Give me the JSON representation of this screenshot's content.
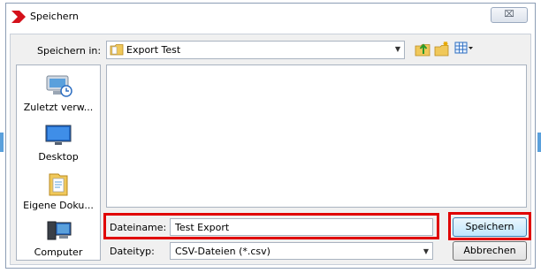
{
  "window": {
    "title": "Speichern",
    "close_glyph": "⌧"
  },
  "toolbar": {
    "save_in_label": "Speichern in:",
    "current_folder": "Export Test",
    "icons": [
      "up-folder-icon",
      "new-folder-icon",
      "view-menu-icon"
    ]
  },
  "places": [
    {
      "label": "Zuletzt verw...",
      "icon": "recent-places-icon"
    },
    {
      "label": "Desktop",
      "icon": "desktop-icon"
    },
    {
      "label": "Eigene Doku...",
      "icon": "documents-icon"
    },
    {
      "label": "Computer",
      "icon": "computer-icon"
    }
  ],
  "filename": {
    "label": "Dateiname:",
    "value": "Test Export"
  },
  "filetype": {
    "label": "Dateityp:",
    "value": "CSV-Dateien (*.csv)"
  },
  "buttons": {
    "save": "Speichern",
    "cancel": "Abbrechen"
  },
  "colors": {
    "highlight": "#e00000",
    "title_icon": "#d4101a"
  }
}
